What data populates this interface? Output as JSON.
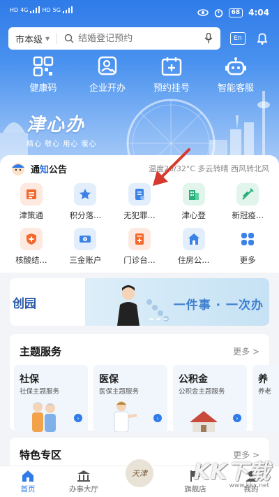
{
  "statusbar": {
    "left_labels": [
      "HD",
      "4G",
      "HD",
      "5G"
    ],
    "battery": "68",
    "time": "4:04"
  },
  "search": {
    "city": "市本级",
    "placeholder": "结婚登记预约",
    "lang_button": "En"
  },
  "quick_services": [
    {
      "label": "健康码",
      "icon": "qr-code-icon"
    },
    {
      "label": "企业开办",
      "icon": "business-person-icon"
    },
    {
      "label": "预约挂号",
      "icon": "medical-calendar-icon"
    },
    {
      "label": "智能客服",
      "icon": "robot-icon"
    }
  ],
  "brand": {
    "title": "津心办",
    "slogan": "精心 敬心 用心 暖心"
  },
  "notice": {
    "title_prefix": "通",
    "title_highlight": "知",
    "title_suffix": "公告",
    "weather": "温度20/32°C 多云转晴 西风转北风"
  },
  "service_grid": [
    [
      {
        "label": "津策通",
        "icon": "policy-icon",
        "bg": "#fde9df",
        "color": "#f2692d"
      },
      {
        "label": "积分落...",
        "icon": "star-badge-icon",
        "bg": "#e3eefc",
        "color": "#3b82e6"
      },
      {
        "label": "无犯罪...",
        "icon": "certificate-icon",
        "bg": "#e3eefc",
        "color": "#3b82e6"
      },
      {
        "label": "津心登",
        "icon": "building-icon",
        "bg": "#e1f5ec",
        "color": "#27b07a"
      },
      {
        "label": "新冠疫...",
        "icon": "syringe-icon",
        "bg": "#e1f5ec",
        "color": "#27b07a"
      }
    ],
    [
      {
        "label": "核酸结...",
        "icon": "shield-plus-icon",
        "bg": "#fde9df",
        "color": "#f2692d"
      },
      {
        "label": "三金账户",
        "icon": "money-icon",
        "bg": "#e3eefc",
        "color": "#3b82e6"
      },
      {
        "label": "门诊台...",
        "icon": "clinic-doc-icon",
        "bg": "#fde9df",
        "color": "#f2692d"
      },
      {
        "label": "住房公...",
        "icon": "house-icon",
        "bg": "#e3eefc",
        "color": "#3b82e6"
      },
      {
        "label": "更多",
        "icon": "more-grid-icon",
        "bg": "#ffffff",
        "color": "#3b82e6"
      }
    ]
  ],
  "banner": {
    "left_text": "创园",
    "slogan": "一件事 · 一次办"
  },
  "theme_section": {
    "title": "主题服务",
    "more": "更多 >",
    "cards": [
      {
        "title": "社保",
        "sub": "社保主题服务"
      },
      {
        "title": "医保",
        "sub": "医保主题服务"
      },
      {
        "title": "公积金",
        "sub": "公积金主题服务"
      },
      {
        "title": "养",
        "sub": "养老"
      }
    ]
  },
  "special_section": {
    "title": "特色专区",
    "more": "更多 >"
  },
  "tabbar": {
    "items": [
      {
        "label": "首页",
        "active": true
      },
      {
        "label": "办事大厅",
        "active": false
      },
      {
        "label": "",
        "center": "天津"
      },
      {
        "label": "旗舰店",
        "active": false
      },
      {
        "label": "我的",
        "active": false
      }
    ]
  },
  "watermark": {
    "text": "KK下载",
    "url": "www.kkx.net"
  },
  "colors": {
    "primary": "#2f7be8",
    "arrow": "#d63a2e"
  }
}
